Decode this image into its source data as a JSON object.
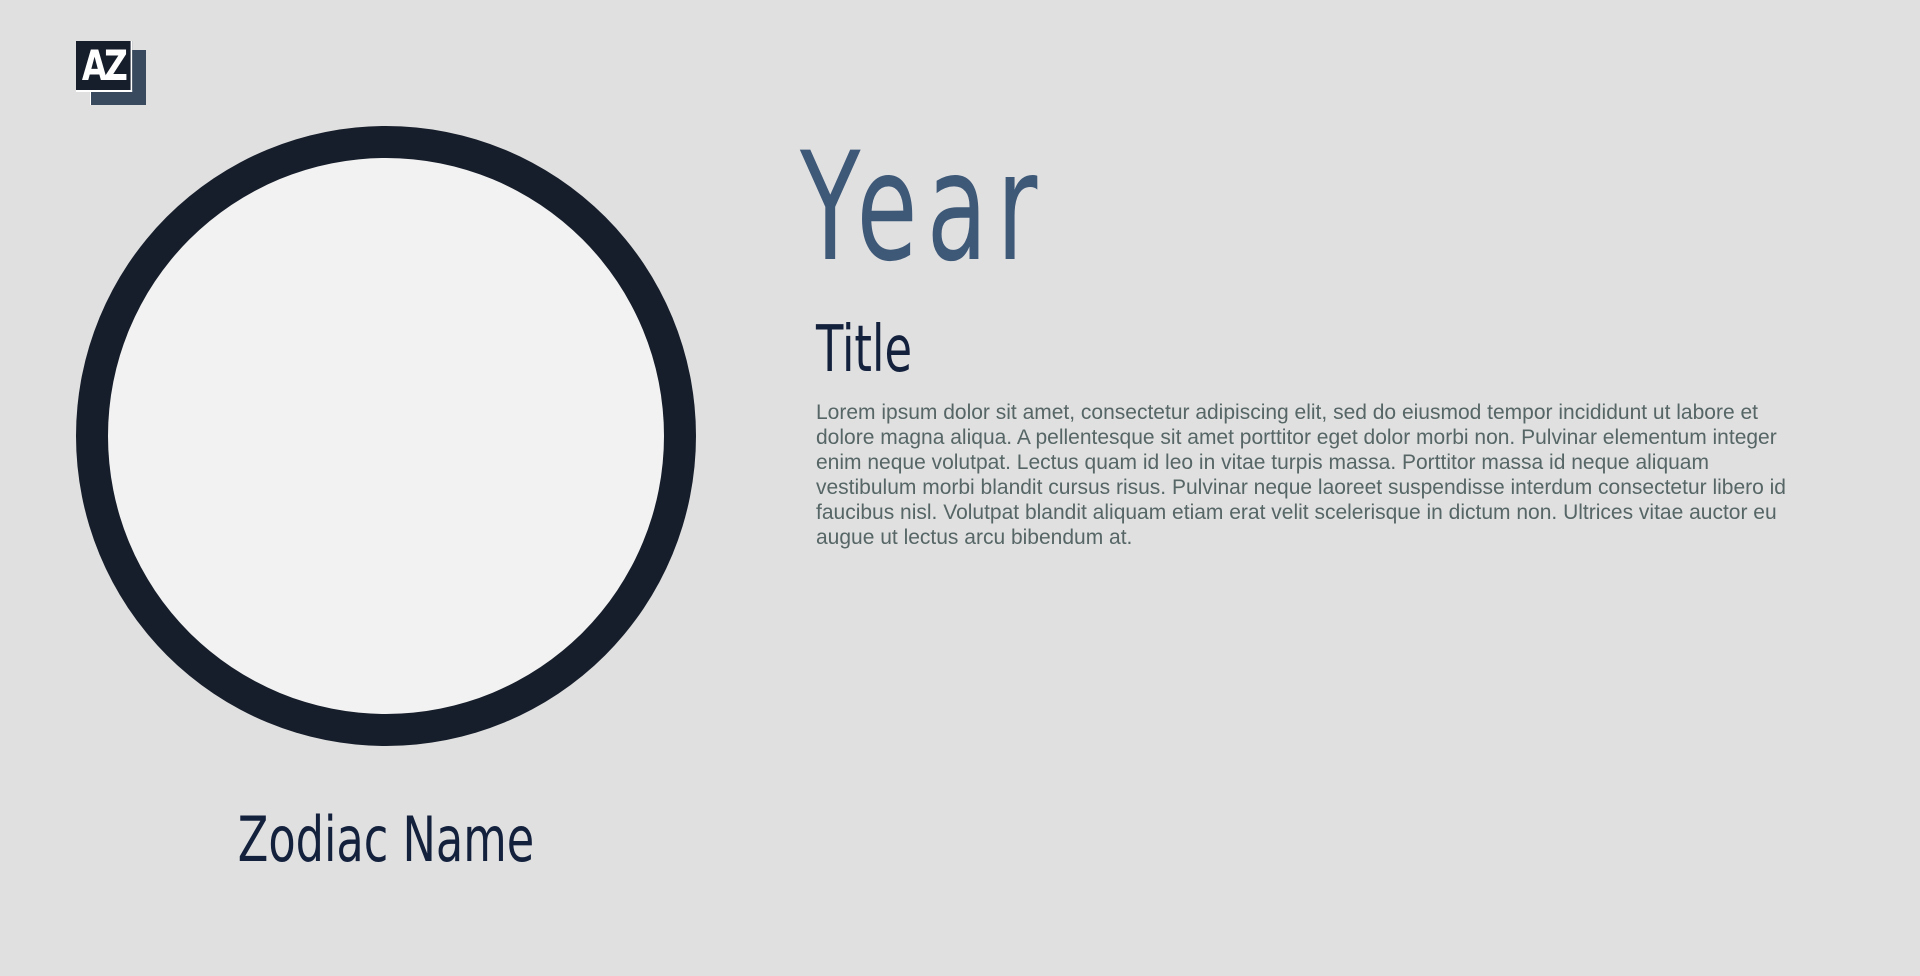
{
  "logo": {
    "text": "AZ"
  },
  "zodiac": {
    "name": "Zodiac Name"
  },
  "content": {
    "year": "Year",
    "title": "Title",
    "body": "Lorem ipsum dolor sit amet, consectetur adipiscing elit, sed do eiusmod tempor incididunt ut labore et dolore magna aliqua. A pellentesque sit amet porttitor eget dolor morbi non. Pulvinar elementum integer enim neque volutpat. Lectus quam id leo in vitae turpis massa. Porttitor massa id neque aliquam vestibulum morbi blandit cursus risus. Pulvinar neque laoreet suspendisse interdum consectetur libero id faucibus nisl. Volutpat blandit aliquam etiam erat velit scelerisque in dictum non. Ultrices vitae auctor eu augue ut lectus arcu bibendum at."
  },
  "colors": {
    "background": "#e0e0e0",
    "ring": "#171e2b",
    "ring_fill": "#f2f2f2",
    "year": "#3e5878",
    "heading": "#14213d",
    "body_text": "#566565"
  }
}
